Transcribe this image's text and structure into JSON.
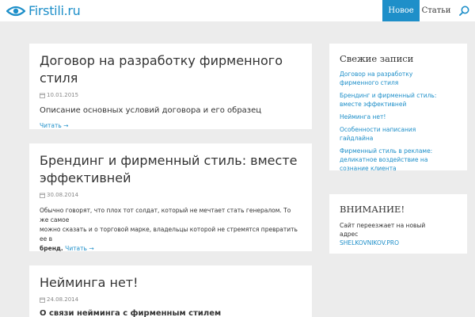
{
  "header": {
    "logo_text": "Firstili.ru",
    "nav": [
      {
        "label": "Новое",
        "active": true
      },
      {
        "label": "Статьи",
        "active": false
      }
    ],
    "accent_color": "#1e8fc9"
  },
  "posts": [
    {
      "title": "Договор на разработку фирменного стиля",
      "date": "10.01.2015",
      "excerpt": "Описание основных условий договора и его образец",
      "read_more": "Читать →"
    },
    {
      "title_line1": "Брендинг и фирменный стиль: вместе",
      "title_line2": "эффективней",
      "date": "30.08.2014",
      "excerpt_line1": "Обычно говорят, что плох тот солдат, который не мечтает стать генералом. То же самое",
      "excerpt_line2": "можно сказать и о торговой марке, владельцы которой не стремятся превратить ее в",
      "excerpt_bold": "бренд.",
      "read_more": "Читать →"
    },
    {
      "title": "Нейминга нет!",
      "date": "24.08.2014",
      "excerpt_partial": "О связи нейминга с фирменным стилем"
    }
  ],
  "sidebar": {
    "recent": {
      "title": "Свежие записи",
      "items": [
        {
          "line1": "Договор на разработку",
          "line2": "фирменного стиля"
        },
        {
          "line1": "Брендинг и фирменный стиль:",
          "line2": "вместе эффективней"
        },
        {
          "line1": "Нейминга нет!",
          "line2": ""
        },
        {
          "line1": "Особенности написания",
          "line2": "гайдлайна"
        },
        {
          "line1": "Фирменный стиль в рекламе:",
          "line2": "деликатное воздействие на",
          "line3": "сознание клиента"
        }
      ]
    },
    "notice": {
      "title": "ВНИМАНИЕ!",
      "text_line1": "Сайт переезжает на новый",
      "text_line2": "адрес",
      "link": "SHELKOVNIKOV.PRO"
    }
  }
}
